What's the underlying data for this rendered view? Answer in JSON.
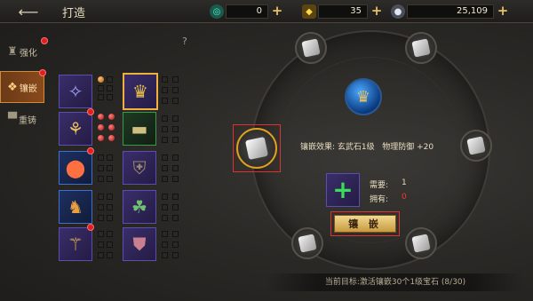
{
  "header": {
    "title": "打造",
    "currencies": [
      {
        "name": "jade",
        "value": "0",
        "icon": "jade-swirl-icon",
        "color": "#36c8a0"
      },
      {
        "name": "gold-ingot",
        "value": "35",
        "icon": "gold-ingot-icon",
        "color": "#e8b830"
      },
      {
        "name": "silver",
        "value": "25,109",
        "icon": "silver-coin-icon",
        "color": "#b0b8c8"
      }
    ]
  },
  "tabs": [
    {
      "label": "强化",
      "active": false
    },
    {
      "label": "镶嵌",
      "active": true
    },
    {
      "label": "重铸",
      "active": false
    }
  ],
  "help": "?",
  "inlay": {
    "effect_label": "镶嵌效果:",
    "effect_stone": "玄武石1级",
    "effect_stat": "物理防御",
    "effect_value": "+20",
    "need_label": "需要:",
    "need_value": "1",
    "have_label": "拥有:",
    "have_value": "0",
    "button_label": "镶 嵌"
  },
  "goal": {
    "text": "当前目标:激活镶嵌30个1级宝石",
    "progress": "(8/30)"
  }
}
